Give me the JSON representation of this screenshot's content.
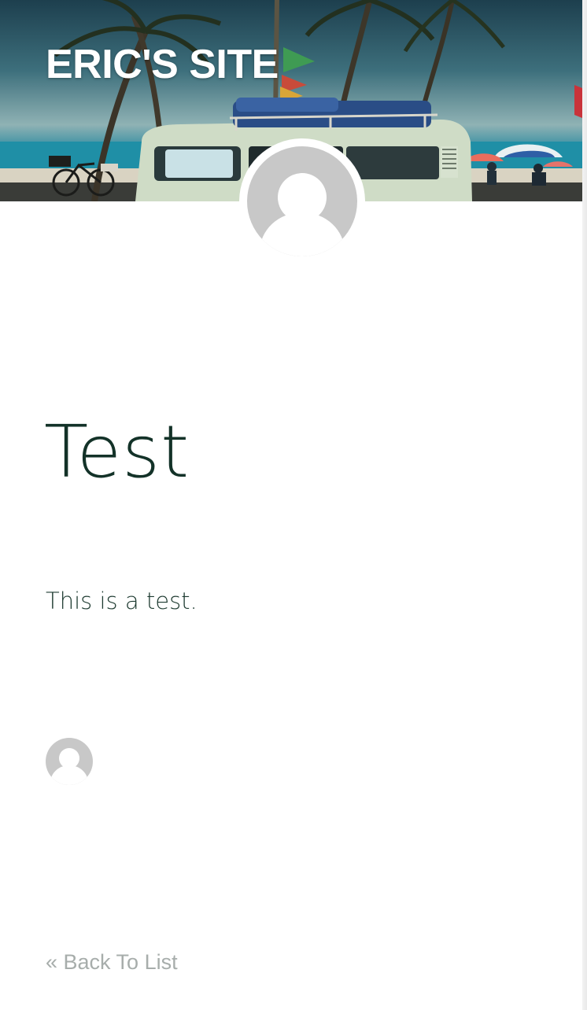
{
  "header": {
    "site_title": "ERIC'S SITE",
    "banner_image": "beach-van-banner",
    "accent_color": "#ffffff"
  },
  "author": {
    "avatar_icon": "default-user-avatar-icon"
  },
  "post": {
    "title": "Test",
    "body": "This is a test.",
    "title_color": "#133228"
  },
  "footer": {
    "back_link_label": "« Back To List",
    "link_color": "#a7adab"
  }
}
